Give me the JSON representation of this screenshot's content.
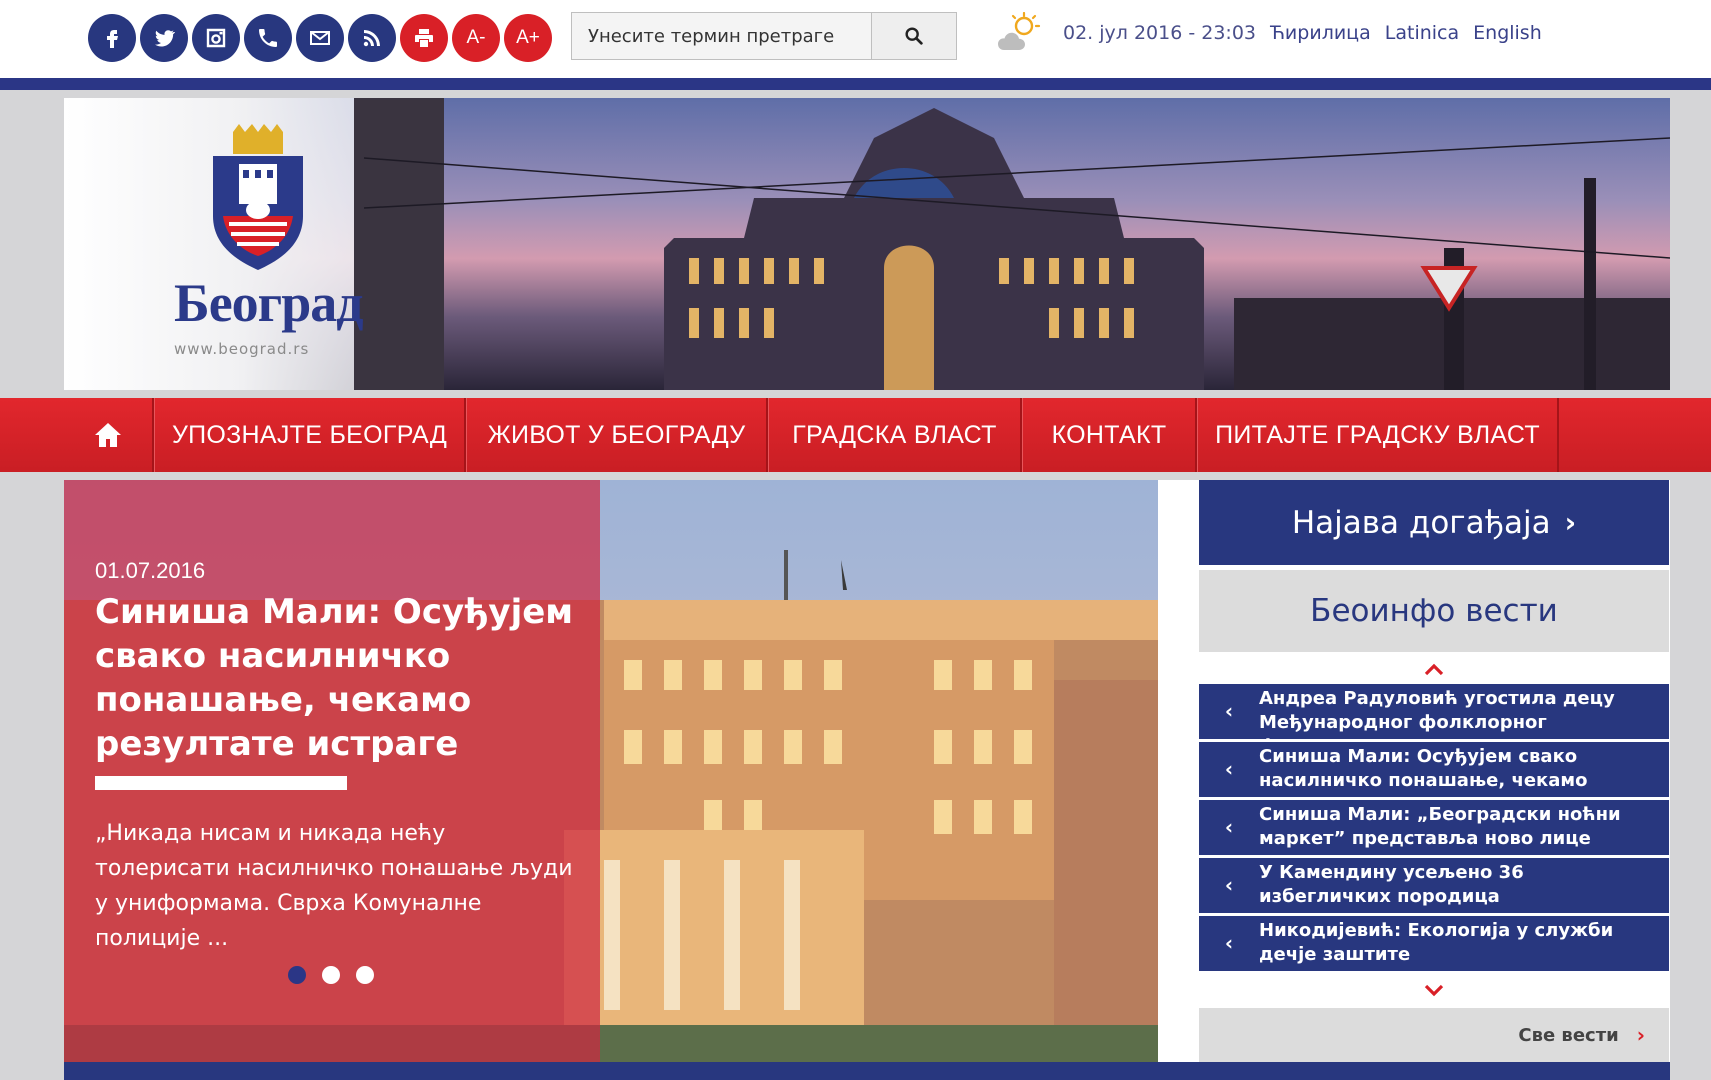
{
  "header": {
    "social_icons": [
      {
        "name": "facebook-icon",
        "color": "#28377f"
      },
      {
        "name": "twitter-icon",
        "color": "#28377f"
      },
      {
        "name": "instagram-icon",
        "color": "#28377f"
      },
      {
        "name": "phone-icon",
        "color": "#28377f"
      },
      {
        "name": "mail-icon",
        "color": "#28377f"
      },
      {
        "name": "rss-icon",
        "color": "#28377f"
      },
      {
        "name": "print-icon",
        "color": "#d92027"
      }
    ],
    "font_decrease_label": "A-",
    "font_increase_label": "A+",
    "search": {
      "placeholder": "Унесите термин претраге"
    },
    "weather_icon": "partly-cloudy-icon",
    "datetime": "02. јул 2016 - 23:03",
    "languages": [
      "Ћирилица",
      "Latinica",
      "English"
    ]
  },
  "banner": {
    "logo_text": "Београд",
    "logo_url": "www.beograd.rs"
  },
  "nav": {
    "home_icon": "home-icon",
    "items": [
      "УПОЗНАЈТЕ БЕОГРАД",
      "ЖИВОТ У БЕОГРАДУ",
      "ГРАДСКА ВЛАСТ",
      "КОНТАКТ",
      "ПИТАЈТЕ ГРАДСКУ ВЛАСТ"
    ]
  },
  "slider": {
    "date": "01.07.2016",
    "title": "Синиша Мали: Осуђујем свако насилничко понашање, чекамо резултате истраге",
    "excerpt": "„Никада нисам и никада нећу толерисати насилничко понашање људи у униформама. Сврха Комуналне полиције ...",
    "slide_count": 3,
    "active_slide": 1
  },
  "sidebar": {
    "events_label": "Најава догађаја",
    "beoinfo_title": "Беоинфо вести",
    "news": [
      "Андреа Радуловић угостила децу Међународног фолклорног фестивала „Београд”",
      "Синиша Мали: Осуђујем свако насилничко понашање, чекамо",
      "Синиша Мали: „Београдски ноћни маркет” представља ново лице",
      "У Камендину усељено 36 избегличких породица",
      "Никодијевић: Екологија у служби дечје заштите"
    ],
    "all_news_label": "Све вести"
  },
  "colors": {
    "brand_blue": "#28377f",
    "brand_red": "#d92027",
    "nav_red": "#e2272d"
  }
}
